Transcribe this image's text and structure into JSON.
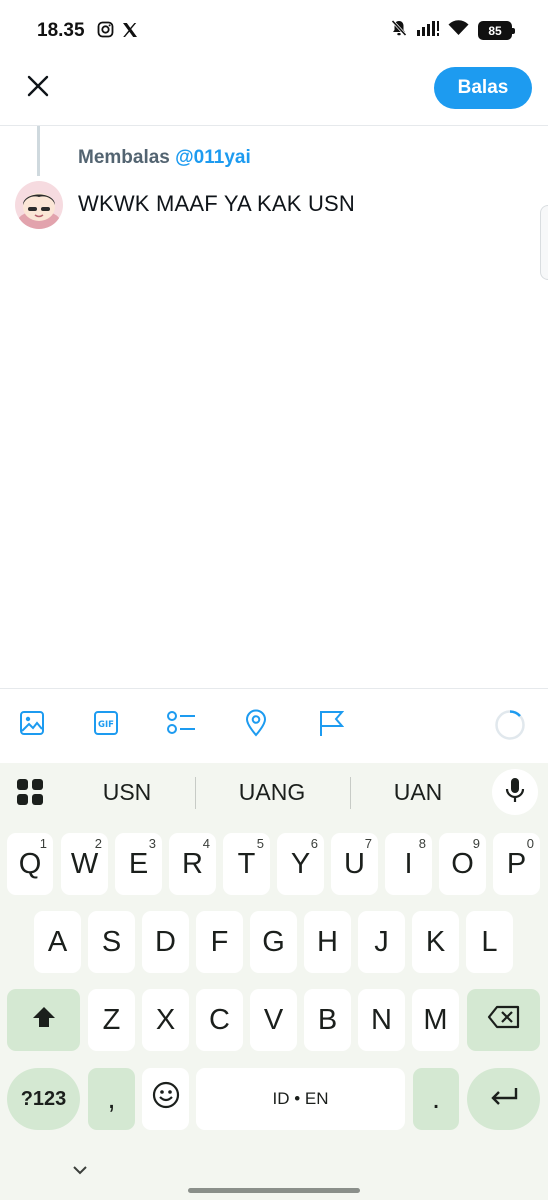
{
  "status_bar": {
    "time": "18.35",
    "battery": "85",
    "icons": [
      "instagram-icon",
      "x-logo-icon",
      "bell-off-icon",
      "signal-icon",
      "wifi-icon",
      "battery-icon"
    ]
  },
  "header": {
    "reply_label": "Balas",
    "close_icon": "close-icon"
  },
  "reply": {
    "prefix": "Membalas",
    "handle": "@011yai",
    "text": "WKWK MAAF YA KAK USN"
  },
  "toolbar": {
    "items": [
      "image-icon",
      "gif-icon",
      "poll-icon",
      "location-icon",
      "flag-icon"
    ]
  },
  "keyboard": {
    "suggestions": [
      "USN",
      "UANG",
      "UAN"
    ],
    "row1": [
      {
        "label": "Q",
        "num": "1"
      },
      {
        "label": "W",
        "num": "2"
      },
      {
        "label": "E",
        "num": "3"
      },
      {
        "label": "R",
        "num": "4"
      },
      {
        "label": "T",
        "num": "5"
      },
      {
        "label": "Y",
        "num": "6"
      },
      {
        "label": "U",
        "num": "7"
      },
      {
        "label": "I",
        "num": "8"
      },
      {
        "label": "O",
        "num": "9"
      },
      {
        "label": "P",
        "num": "0"
      }
    ],
    "row2": [
      "A",
      "S",
      "D",
      "F",
      "G",
      "H",
      "J",
      "K",
      "L"
    ],
    "row3": [
      "Z",
      "X",
      "C",
      "V",
      "B",
      "N",
      "M"
    ],
    "symbols_label": "?123",
    "comma_label": ",",
    "space_label": "ID • EN",
    "period_label": "."
  },
  "colors": {
    "accent": "#1d9bf0",
    "keyboard_bg": "#f3f6f0",
    "key_green": "#d4e8d2"
  }
}
